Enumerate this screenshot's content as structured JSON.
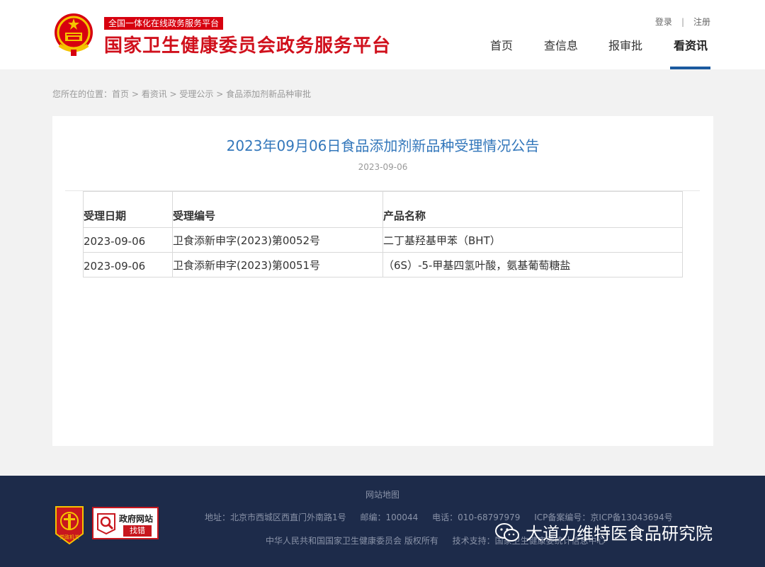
{
  "header": {
    "badge": "全国一体化在线政务服务平台",
    "site_title": "国家卫生健康委员会政务服务平台",
    "login": "登录",
    "separator": "|",
    "register": "注册",
    "nav": [
      "首页",
      "查信息",
      "报审批",
      "看资讯"
    ],
    "active_nav": "看资讯"
  },
  "breadcrumb": {
    "prefix": "您所在的位置：",
    "items": [
      "首页",
      "看资讯",
      "受理公示",
      "食品添加剂新品种审批"
    ],
    "sep": " > "
  },
  "article": {
    "title": "2023年09月06日食品添加剂新品种受理情况公告",
    "date": "2023-09-06",
    "table": {
      "headers": [
        "受理日期",
        "受理编号",
        "产品名称"
      ],
      "rows": [
        [
          "2023-09-06",
          "卫食添新申字(2023)第0052号",
          "二丁基羟基甲苯（BHT）"
        ],
        [
          "2023-09-06",
          "卫食添新申字(2023)第0051号",
          "（6S）-5-甲基四氢叶酸，氨基葡萄糖盐"
        ]
      ]
    }
  },
  "footer": {
    "site_map": "网站地图",
    "address": "地址：北京市西城区西直门外南路1号",
    "postcode": "邮编：100044",
    "phone": "电话：010-68797979",
    "icp": "ICP备案编号：京ICP备13043694号",
    "copyright": "中华人民共和国国家卫生健康委员会 版权所有",
    "tech_support": "技术支持：国家卫生健康委统计信息中心",
    "gov_badge_title": "政府网站",
    "gov_badge_action": "找错",
    "party_label": "党政机关",
    "watermark": "大道力维特医食品研究院"
  },
  "colors": {
    "brand_red": "#d0101c",
    "link_blue": "#3377bb",
    "nav_underline": "#1b5a9f",
    "footer_bg": "#1d2b4a"
  }
}
